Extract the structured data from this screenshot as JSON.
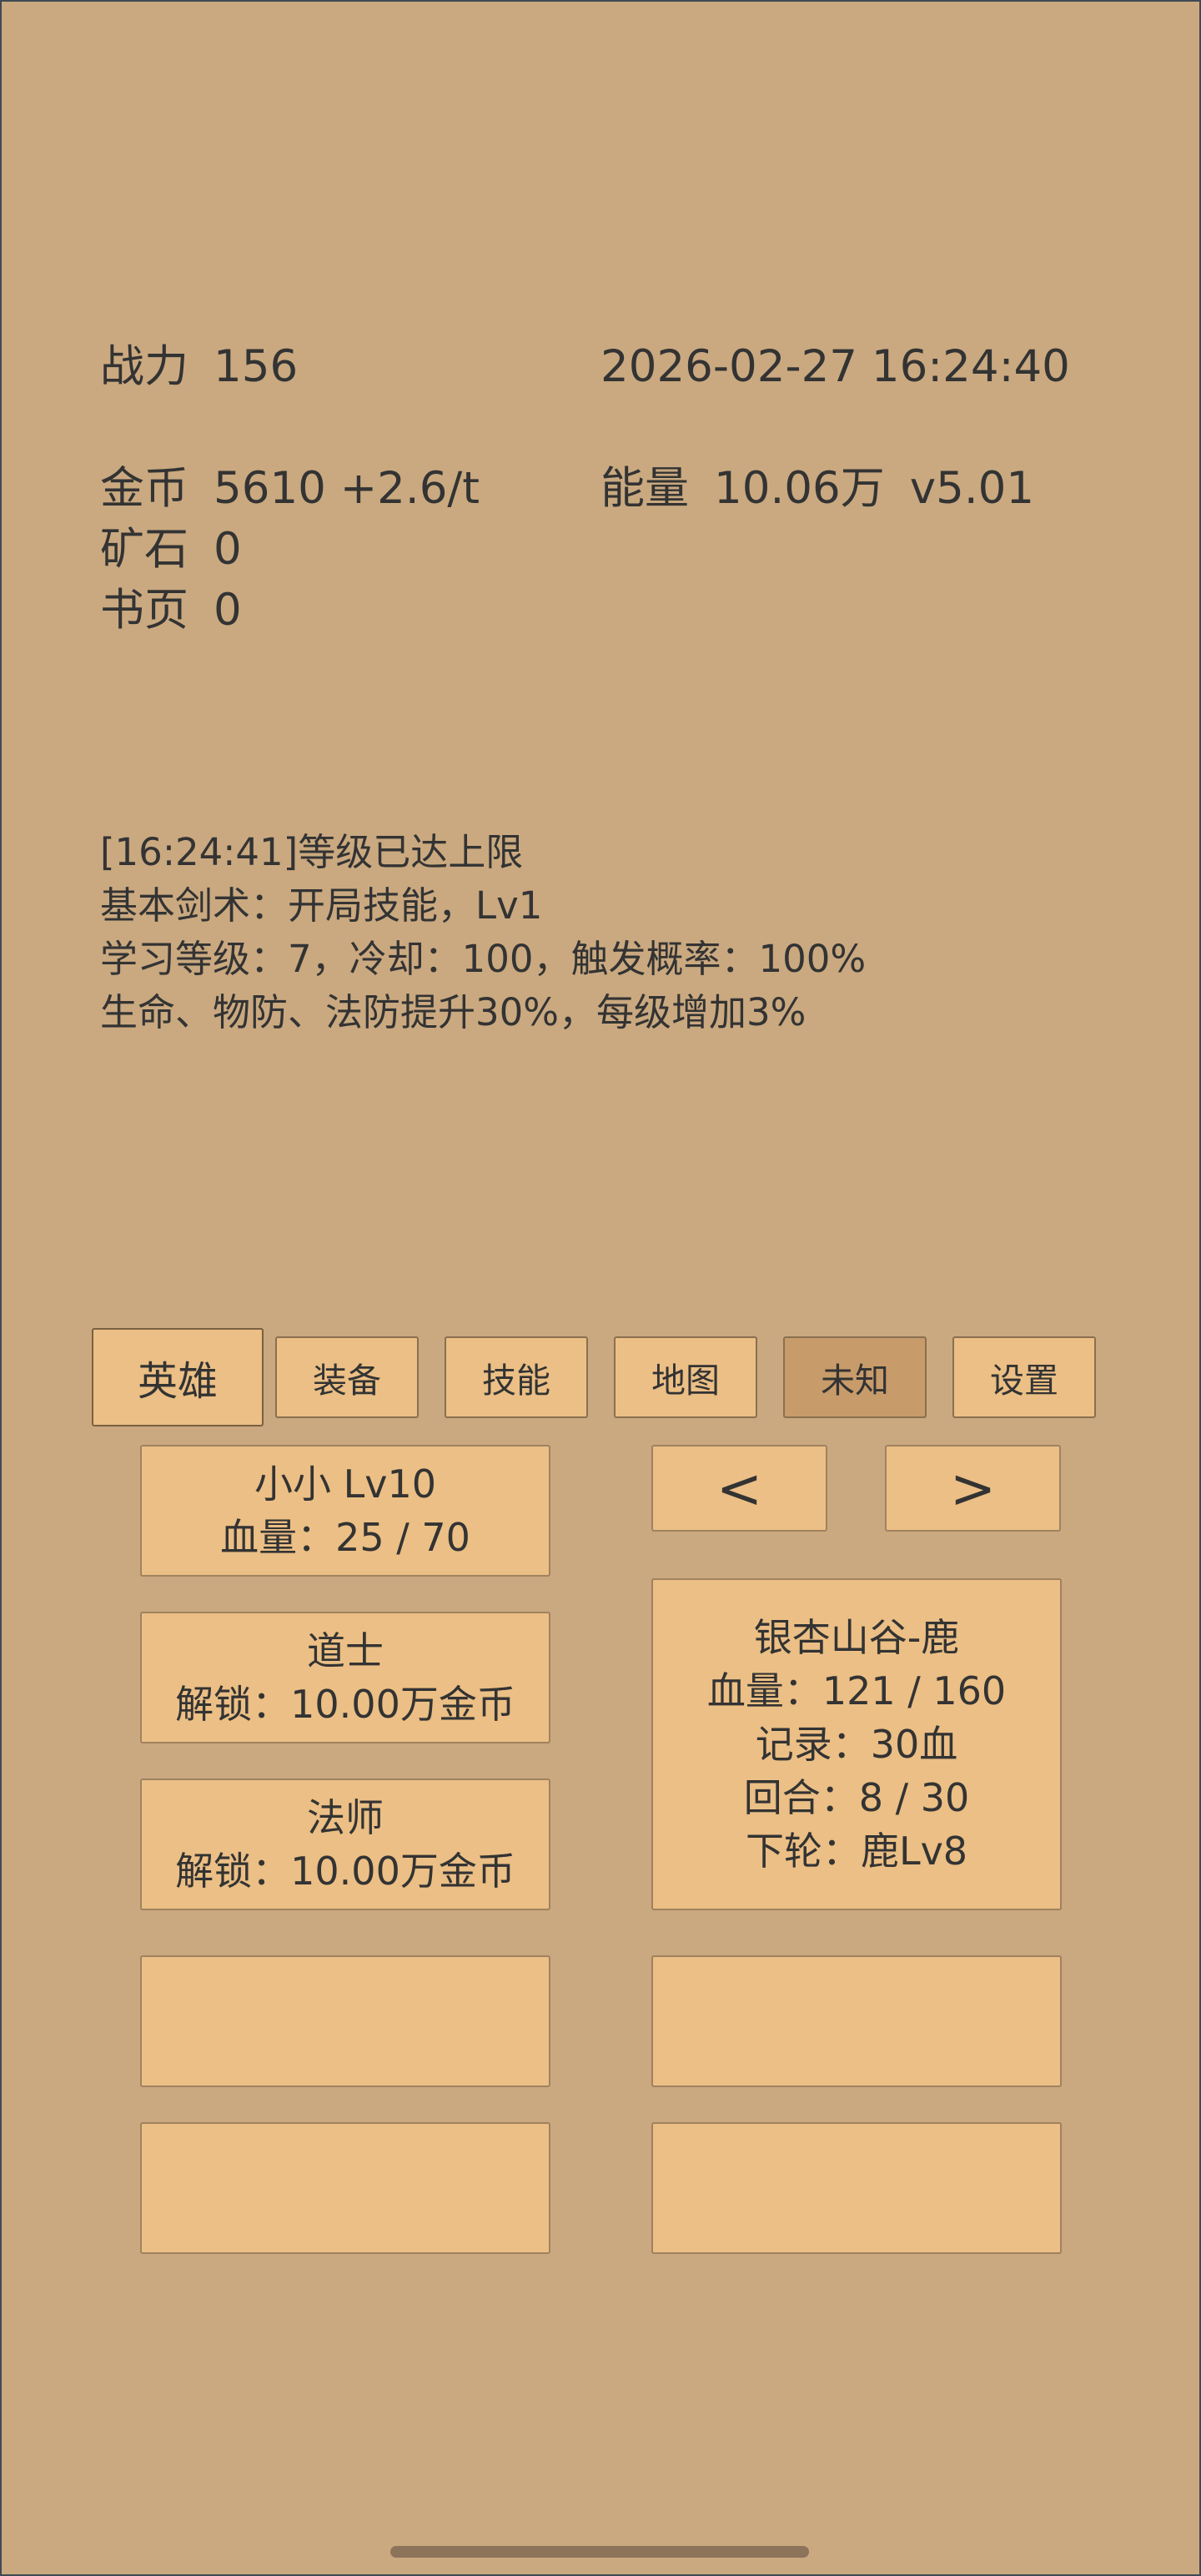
{
  "stats": {
    "power_label": "战力",
    "power_value": "156",
    "datetime": "2026-02-27 16:24:40",
    "gold_label": "金币",
    "gold_value": "5610 +2.6/t",
    "energy_label": "能量",
    "energy_value": "10.06万",
    "version": "v5.01",
    "ore_label": "矿石",
    "ore_value": "0",
    "pages_label": "书页",
    "pages_value": "0"
  },
  "log": [
    "[16:24:41]等级已达上限",
    "基本剑术：开局技能，Lv1",
    "学习等级：7，冷却：100，触发概率：100%",
    "生命、物防、法防提升30%，每级增加3%"
  ],
  "tabs": [
    {
      "id": "hero",
      "label": "英雄"
    },
    {
      "id": "equip",
      "label": "装备"
    },
    {
      "id": "skill",
      "label": "技能"
    },
    {
      "id": "map",
      "label": "地图"
    },
    {
      "id": "unknown",
      "label": "未知"
    },
    {
      "id": "settings",
      "label": "设置"
    }
  ],
  "heroes": [
    {
      "name": "小小 Lv10",
      "detail": "血量：25 / 70"
    },
    {
      "name": "道士",
      "detail": "解锁：10.00万金币"
    },
    {
      "name": "法师",
      "detail": "解锁：10.00万金币"
    }
  ],
  "nav": {
    "prev": "<",
    "next": ">"
  },
  "enemy": {
    "name": "银杏山谷-鹿",
    "hp": "血量：121 / 160",
    "record": "记录：30血",
    "round": "回合：8 / 30",
    "next": "下轮：鹿Lv8"
  },
  "colors": {
    "background": "#caa980",
    "panel": "#ebbf85",
    "tab_dim": "#c89b6b",
    "text": "#333333"
  }
}
